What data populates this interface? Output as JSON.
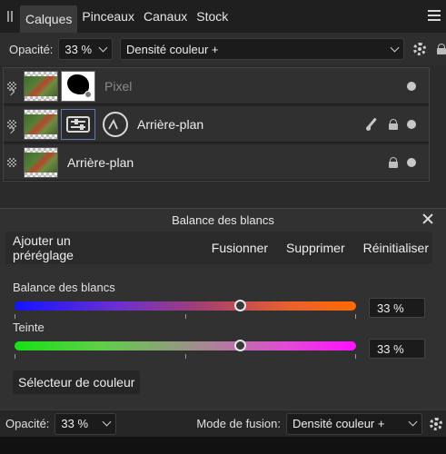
{
  "tabs": [
    {
      "label": "Calques",
      "active": true
    },
    {
      "label": "Pinceaux",
      "active": false
    },
    {
      "label": "Canaux",
      "active": false
    },
    {
      "label": "Stock",
      "active": false
    }
  ],
  "layer_toolbar": {
    "opacity_label": "Opacité:",
    "opacity_value": "33 %",
    "blend_mode": "Densité couleur +"
  },
  "layers": [
    {
      "name": "Pixel",
      "dimmed": true
    },
    {
      "name": "Arrière-plan",
      "dimmed": false
    },
    {
      "name": "Arrière-plan",
      "dimmed": false
    }
  ],
  "dialog": {
    "title": "Balance des blancs",
    "add_preset": "Ajouter un préréglage",
    "merge": "Fusionner",
    "delete": "Supprimer",
    "reset": "Réinitialiser",
    "sliders": [
      {
        "label": "Balance des blancs",
        "value_text": "33 %",
        "position": 0.66
      },
      {
        "label": "Teinte",
        "value_text": "33 %",
        "position": 0.66
      }
    ],
    "color_picker": "Sélecteur de couleur"
  },
  "bottom": {
    "opacity_label": "Opacité:",
    "opacity_value": "33 %",
    "blend_label": "Mode de fusion:",
    "blend_value": "Densité couleur +"
  }
}
